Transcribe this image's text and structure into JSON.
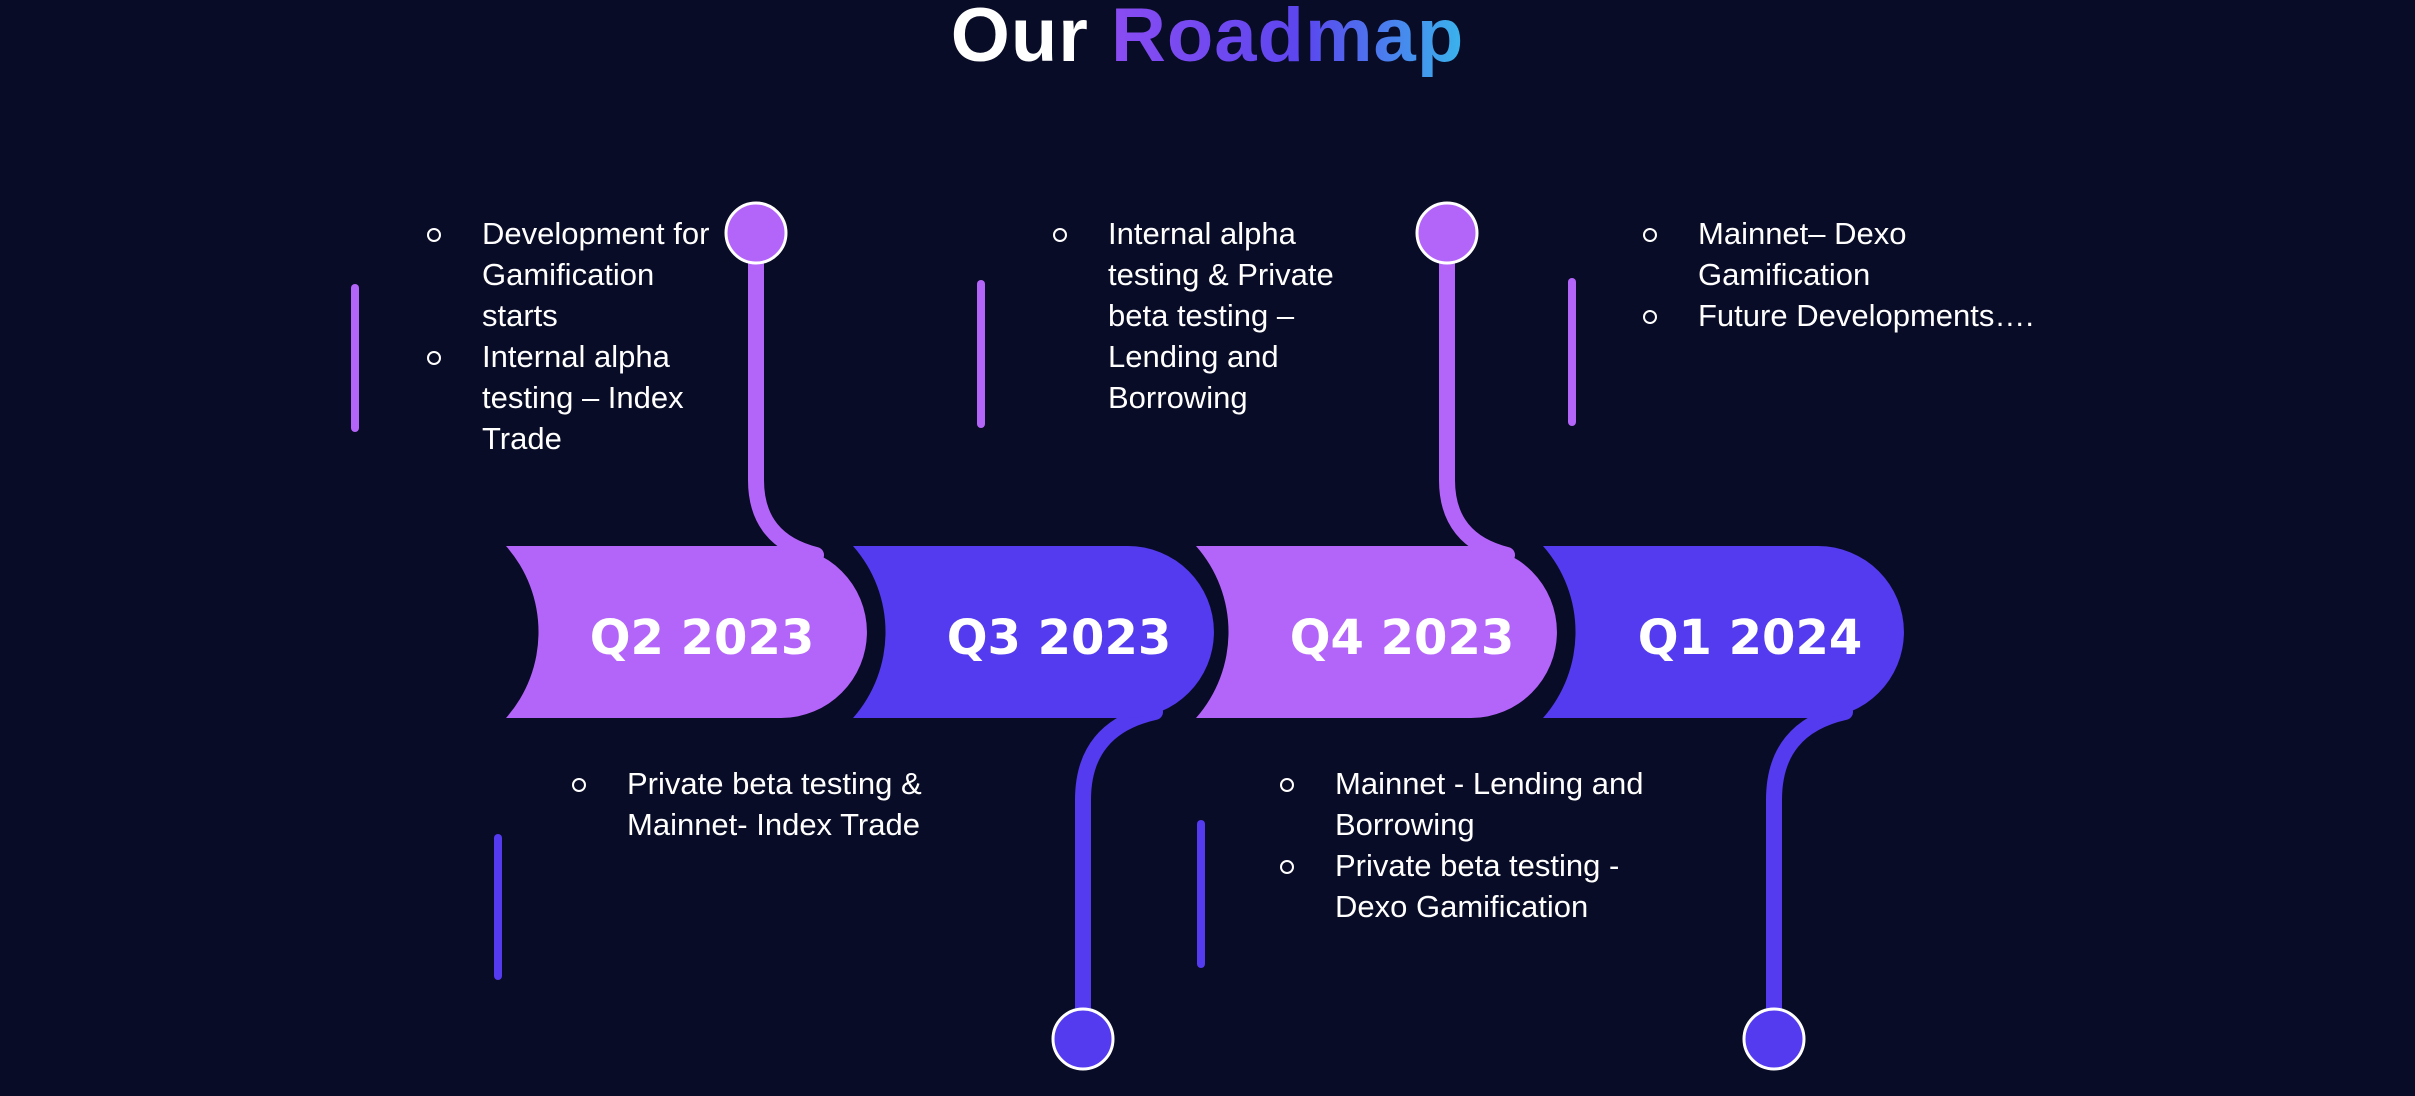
{
  "title": {
    "text": "Our",
    "highlight": "Roadmap"
  },
  "milestones": [
    {
      "label": "Q2 2023",
      "color": "#b465f9",
      "items": [
        "Development for Gamification starts",
        "Internal alpha testing – Index Trade"
      ]
    },
    {
      "label": "Q3 2023",
      "color": "#543bef",
      "items": [
        "Private beta testing & Mainnet- Index Trade"
      ]
    },
    {
      "label": "Q4 2023",
      "color": "#b465f9",
      "items": [
        "Internal alpha testing & Private beta testing – Lending and Borrowing"
      ]
    },
    {
      "label": "Q1 2024",
      "color": "#543bef",
      "items": [
        "Mainnet - Lending and Borrowing",
        "Private beta testing - Dexo Gamification"
      ]
    }
  ],
  "extra_notes": {
    "items": [
      "Mainnet– Dexo Gamification",
      "Future Developments…."
    ]
  },
  "colors": {
    "background": "#090c26",
    "purple": "#b465f9",
    "indigo": "#543bef",
    "accent_blue": "#3ab4ec"
  }
}
